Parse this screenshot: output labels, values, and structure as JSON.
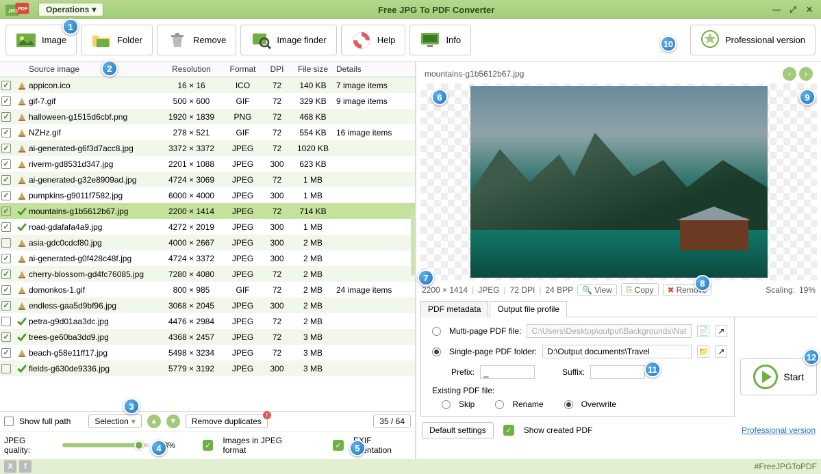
{
  "app": {
    "title": "Free JPG To PDF Converter",
    "operations_label": "Operations"
  },
  "toolbar": {
    "image": "Image",
    "folder": "Folder",
    "remove": "Remove",
    "image_finder": "Image finder",
    "help": "Help",
    "info": "Info",
    "pro_version": "Professional version"
  },
  "columns": {
    "source": "Source image",
    "res": "Resolution",
    "fmt": "Format",
    "dpi": "DPI",
    "size": "File size",
    "details": "Details"
  },
  "rows": [
    {
      "chk": true,
      "st": "hg",
      "name": "appicon.ico",
      "res": "16 × 16",
      "fmt": "ICO",
      "dpi": "72",
      "size": "140 KB",
      "det": "7 image items"
    },
    {
      "chk": true,
      "st": "hg",
      "name": "gif-7.gif",
      "res": "500 × 600",
      "fmt": "GIF",
      "dpi": "72",
      "size": "329 KB",
      "det": "9 image items"
    },
    {
      "chk": true,
      "st": "hg",
      "name": "halloween-g1515d6cbf.png",
      "res": "1920 × 1839",
      "fmt": "PNG",
      "dpi": "72",
      "size": "468 KB",
      "det": ""
    },
    {
      "chk": true,
      "st": "hg",
      "name": "NZHz.gif",
      "res": "278 × 521",
      "fmt": "GIF",
      "dpi": "72",
      "size": "554 KB",
      "det": "16 image items"
    },
    {
      "chk": true,
      "st": "hg",
      "name": "ai-generated-g6f3d7acc8.jpg",
      "res": "3372 × 3372",
      "fmt": "JPEG",
      "dpi": "72",
      "size": "1020 KB",
      "det": ""
    },
    {
      "chk": true,
      "st": "hg",
      "name": "riverm-gd8531d347.jpg",
      "res": "2201 × 1088",
      "fmt": "JPEG",
      "dpi": "300",
      "size": "623 KB",
      "det": ""
    },
    {
      "chk": true,
      "st": "hg",
      "name": "ai-generated-g32e8909ad.jpg",
      "res": "4724 × 3069",
      "fmt": "JPEG",
      "dpi": "72",
      "size": "1 MB",
      "det": ""
    },
    {
      "chk": true,
      "st": "hg",
      "name": "pumpkins-g9011f7582.jpg",
      "res": "6000 × 4000",
      "fmt": "JPEG",
      "dpi": "300",
      "size": "1 MB",
      "det": ""
    },
    {
      "chk": true,
      "st": "ok",
      "name": "mountains-g1b5612b67.jpg",
      "res": "2200 × 1414",
      "fmt": "JPEG",
      "dpi": "72",
      "size": "714 KB",
      "det": "",
      "sel": true
    },
    {
      "chk": true,
      "st": "ok",
      "name": "road-gdafafa4a9.jpg",
      "res": "4272 × 2019",
      "fmt": "JPEG",
      "dpi": "300",
      "size": "1 MB",
      "det": ""
    },
    {
      "chk": false,
      "st": "hg",
      "name": "asia-gdc0cdcf80.jpg",
      "res": "4000 × 2667",
      "fmt": "JPEG",
      "dpi": "300",
      "size": "2 MB",
      "det": ""
    },
    {
      "chk": true,
      "st": "hg",
      "name": "ai-generated-g0f428c48f.jpg",
      "res": "4724 × 3372",
      "fmt": "JPEG",
      "dpi": "300",
      "size": "2 MB",
      "det": ""
    },
    {
      "chk": true,
      "st": "hg",
      "name": "cherry-blossom-gd4fc76085.jpg",
      "res": "7280 × 4080",
      "fmt": "JPEG",
      "dpi": "72",
      "size": "2 MB",
      "det": ""
    },
    {
      "chk": true,
      "st": "hg",
      "name": "domonkos-1.gif",
      "res": "800 × 985",
      "fmt": "GIF",
      "dpi": "72",
      "size": "2 MB",
      "det": "24 image items"
    },
    {
      "chk": true,
      "st": "hg",
      "name": "endless-gaa5d9bf96.jpg",
      "res": "3068 × 2045",
      "fmt": "JPEG",
      "dpi": "300",
      "size": "2 MB",
      "det": ""
    },
    {
      "chk": false,
      "st": "ok",
      "name": "petra-g9d01aa3dc.jpg",
      "res": "4476 × 2984",
      "fmt": "JPEG",
      "dpi": "72",
      "size": "2 MB",
      "det": ""
    },
    {
      "chk": true,
      "st": "ok",
      "name": "trees-ge60ba3dd9.jpg",
      "res": "4368 × 2457",
      "fmt": "JPEG",
      "dpi": "72",
      "size": "3 MB",
      "det": ""
    },
    {
      "chk": true,
      "st": "hg",
      "name": "beach-g58e11ff17.jpg",
      "res": "5498 × 3234",
      "fmt": "JPEG",
      "dpi": "72",
      "size": "3 MB",
      "det": ""
    },
    {
      "chk": false,
      "st": "ok",
      "name": "fields-g630de9336.jpg",
      "res": "5779 × 3192",
      "fmt": "JPEG",
      "dpi": "300",
      "size": "3 MB",
      "det": ""
    }
  ],
  "left_footer": {
    "show_full_path": "Show full path",
    "selection": "Selection",
    "remove_dup": "Remove duplicates",
    "count": "35 / 64",
    "jpeg_quality_label": "JPEG quality:",
    "jpeg_quality_value": "88%",
    "images_jpeg": "Images in JPEG format",
    "exif": "EXIF orientation"
  },
  "preview": {
    "filename": "mountains-g1b5612b67.jpg",
    "res": "2200 × 1414",
    "fmt": "JPEG",
    "dpi": "72 DPI",
    "bpp": "24 BPP",
    "view": "View",
    "copy": "Copy",
    "remove": "Remove",
    "scaling_label": "Scaling:",
    "scaling_value": "19%"
  },
  "tabs": {
    "metadata": "PDF metadata",
    "profile": "Output file profile"
  },
  "output": {
    "multi_label": "Multi-page PDF file:",
    "multi_path": "C:\\Users\\Desktop\\output\\Backgrounds\\Nature Images.pdf",
    "single_label": "Single-page PDF folder:",
    "single_path": "D:\\Output documents\\Travel",
    "prefix_label": "Prefix:",
    "prefix_value": "_",
    "suffix_label": "Suffix:",
    "suffix_value": "",
    "existing_label": "Existing PDF file:",
    "skip": "Skip",
    "rename": "Rename",
    "overwrite": "Overwrite",
    "default_settings": "Default settings",
    "show_created": "Show created PDF",
    "start": "Start",
    "pro_link": "Professional version"
  },
  "hashtag": "#FreeJPGToPDF",
  "callouts": {
    "c1": "1",
    "c2": "2",
    "c3": "3",
    "c4": "4",
    "c5": "5",
    "c6": "6",
    "c7": "7",
    "c8": "8",
    "c9": "9",
    "c10": "10",
    "c11": "11",
    "c12": "12"
  }
}
